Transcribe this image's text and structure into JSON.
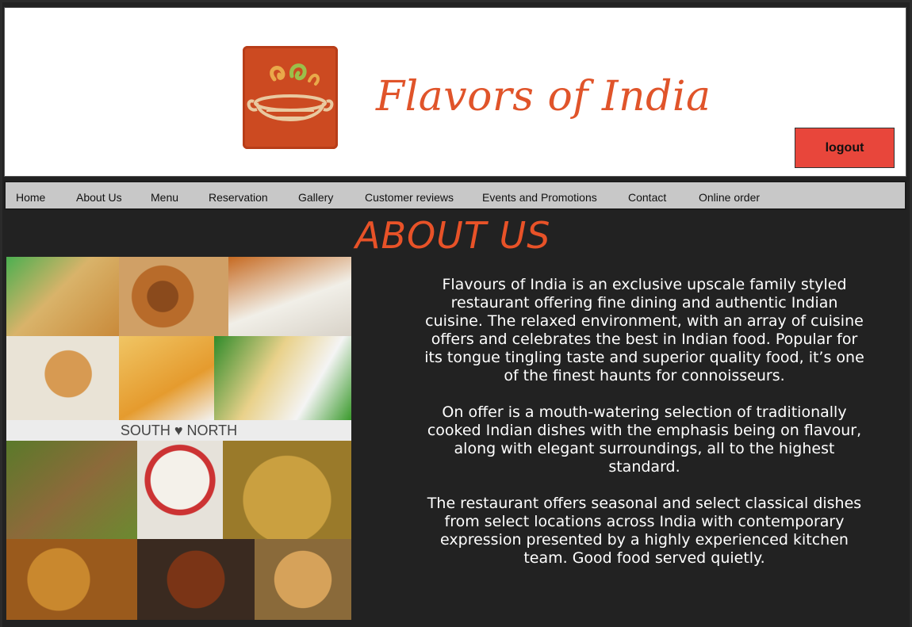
{
  "brand": {
    "name": "Flavors of India",
    "logo_color": "#cc4a21",
    "text_color": "#e0542a"
  },
  "header": {
    "logout_label": "logout",
    "logout_color": "#e8463b"
  },
  "nav": {
    "items": [
      "Home",
      "About Us",
      "Menu",
      "Reservation",
      "Gallery",
      "Customer reviews",
      "Events and Promotions",
      "Contact",
      "Online order"
    ]
  },
  "about": {
    "title": "ABOUT US",
    "title_color": "#e85228",
    "paragraphs": [
      "Flavours of India is an exclusive upscale family styled restaurant offering fine dining and authentic Indian cuisine. The relaxed environment, with an array of cuisine offers and celebrates the best in Indian food. Popular for its tongue tingling taste and superior quality food, it’s one of the finest haunts for connoisseurs.",
      "On offer is a mouth-watering selection of traditionally cooked Indian dishes with the emphasis being on flavour, along with elegant surroundings, all to the highest standard.",
      "The restaurant offers seasonal and select classical dishes from select locations across India with contemporary expression presented by a highly experienced kitchen team. Good food served quietly."
    ]
  },
  "collage": {
    "label": "SOUTH ♥ NORTH"
  }
}
